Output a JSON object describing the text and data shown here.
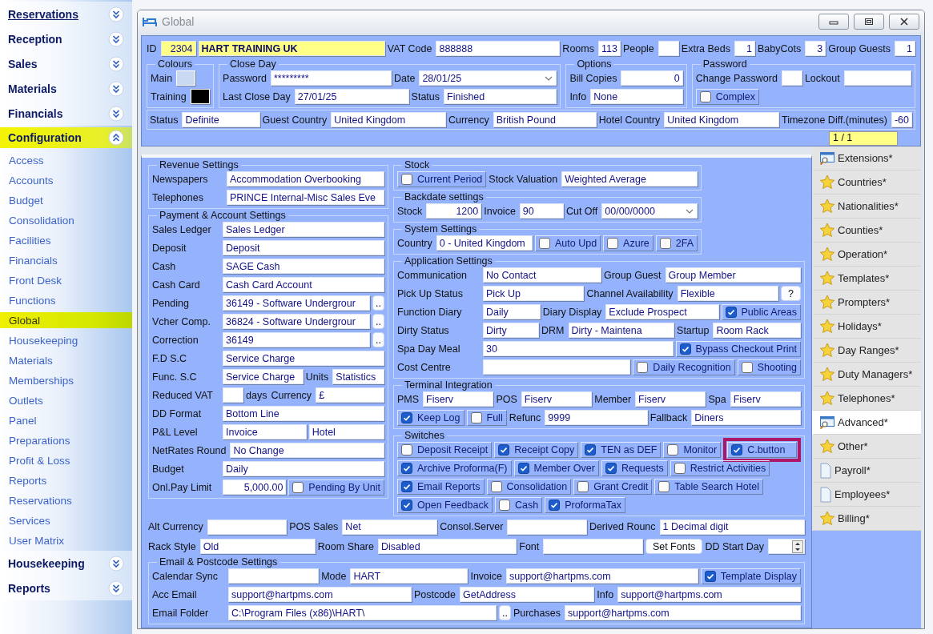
{
  "sidebar": {
    "sections": [
      {
        "title": "Reservations",
        "expanded": false,
        "hovered": true
      },
      {
        "title": "Reception",
        "expanded": false,
        "hovered": false
      },
      {
        "title": "Sales",
        "expanded": false,
        "hovered": false
      },
      {
        "title": "Materials",
        "expanded": false,
        "hovered": false
      },
      {
        "title": "Financials",
        "expanded": false,
        "hovered": false
      },
      {
        "title": "Configuration",
        "expanded": true,
        "hovered": false,
        "items": [
          {
            "label": "Access",
            "selected": false
          },
          {
            "label": "Accounts",
            "selected": false
          },
          {
            "label": "Budget",
            "selected": false
          },
          {
            "label": "Consolidation",
            "selected": false
          },
          {
            "label": "Facilities",
            "selected": false
          },
          {
            "label": "Financials",
            "selected": false
          },
          {
            "label": "Front Desk",
            "selected": false
          },
          {
            "label": "Functions",
            "selected": false
          },
          {
            "label": "Global",
            "selected": true
          },
          {
            "label": "Housekeeping",
            "selected": false
          },
          {
            "label": "Materials",
            "selected": false
          },
          {
            "label": "Memberships",
            "selected": false
          },
          {
            "label": "Outlets",
            "selected": false
          },
          {
            "label": "Panel",
            "selected": false
          },
          {
            "label": "Preparations",
            "selected": false
          },
          {
            "label": "Profit & Loss",
            "selected": false
          },
          {
            "label": "Reports",
            "selected": false
          },
          {
            "label": "Reservations",
            "selected": false
          },
          {
            "label": "Services",
            "selected": false
          },
          {
            "label": "User Matrix",
            "selected": false
          }
        ]
      },
      {
        "title": "Housekeeping",
        "expanded": false,
        "hovered": false
      },
      {
        "title": "Reports",
        "expanded": false,
        "hovered": false
      }
    ]
  },
  "window": {
    "title": "Global"
  },
  "header": {
    "row": [
      {
        "kind": "label",
        "text": "ID"
      },
      {
        "kind": "id",
        "value": "2304"
      },
      {
        "kind": "name",
        "value": "HART TRAINING UK"
      },
      {
        "kind": "label",
        "text": "VAT Code"
      },
      {
        "kind": "field",
        "value": "888888"
      },
      {
        "kind": "label",
        "text": "Rooms"
      },
      {
        "kind": "num",
        "value": "113"
      },
      {
        "kind": "label",
        "text": "People"
      },
      {
        "kind": "num"
      },
      {
        "kind": "label",
        "text": "Extra Beds"
      },
      {
        "kind": "num",
        "value": "1"
      },
      {
        "kind": "label",
        "text": "BabyCots"
      },
      {
        "kind": "num",
        "value": "3"
      },
      {
        "kind": "label",
        "text": "Group Guests"
      },
      {
        "kind": "num",
        "value": "1"
      }
    ],
    "groups": [
      {
        "title": "Colours",
        "rows": [
          {
            "items": [
              {
                "kind": "label",
                "text": "Main"
              },
              {
                "kind": "swatch",
                "color": "#c9d9f2"
              }
            ]
          },
          {
            "items": [
              {
                "kind": "label",
                "text": "Training"
              },
              {
                "kind": "swatch",
                "color": "#000000"
              }
            ]
          }
        ]
      },
      {
        "title": "Close Day",
        "rows": [
          {
            "items": [
              {
                "kind": "label",
                "text": "Password"
              },
              {
                "kind": "field",
                "value": "*********"
              },
              {
                "kind": "label",
                "text": "Date"
              },
              {
                "kind": "date",
                "value": "28/01/25"
              }
            ]
          },
          {
            "items": [
              {
                "kind": "label",
                "text": "Last Close Day"
              },
              {
                "kind": "field",
                "value": "27/01/25"
              },
              {
                "kind": "label",
                "text": "Status"
              },
              {
                "kind": "field",
                "value": "Finished"
              }
            ]
          }
        ]
      },
      {
        "title": "Options",
        "rows": [
          {
            "items": [
              {
                "kind": "label",
                "text": "Bill Copies"
              },
              {
                "kind": "wnum",
                "value": "0"
              }
            ]
          },
          {
            "items": [
              {
                "kind": "label",
                "text": "Info"
              },
              {
                "kind": "field",
                "value": "None"
              }
            ]
          }
        ]
      },
      {
        "title": "Password",
        "rows": [
          {
            "items": [
              {
                "kind": "label",
                "text": "Change Password"
              },
              {
                "kind": "num"
              },
              {
                "kind": "label",
                "text": "Lockout"
              },
              {
                "kind": "wnum"
              }
            ]
          },
          {
            "items": [
              {
                "kind": "check",
                "text": "Complex",
                "checked": false
              }
            ]
          }
        ]
      }
    ],
    "status_row": [
      {
        "kind": "label",
        "text": "Status"
      },
      {
        "kind": "field",
        "value": "Definite"
      },
      {
        "kind": "label",
        "text": "Guest Country"
      },
      {
        "kind": "field",
        "value": "United Kingdom"
      },
      {
        "kind": "label",
        "text": "Currency"
      },
      {
        "kind": "field",
        "value": "British Pound"
      },
      {
        "kind": "label",
        "text": "Hotel Country"
      },
      {
        "kind": "field",
        "value": "United Kingdom"
      },
      {
        "kind": "label",
        "text": "Timezone Diff.(minutes)"
      },
      {
        "kind": "num",
        "value": "-60"
      }
    ],
    "pager": "1 / 1"
  },
  "main": {
    "left": [
      {
        "title": "Revenue Settings",
        "rows": [
          {
            "items": [
              {
                "kind": "label",
                "text": "Newspapers"
              },
              {
                "kind": "field",
                "value": "Accommodation Overbooking"
              }
            ]
          },
          {
            "items": [
              {
                "kind": "label",
                "text": "Telephones"
              },
              {
                "kind": "field",
                "value": "PRINCE Internal-Misc Sales Eve"
              }
            ]
          }
        ]
      },
      {
        "title": "Payment & Account Settings",
        "rows": [
          {
            "items": [
              {
                "kind": "label",
                "text": "Sales Ledger"
              },
              {
                "kind": "field",
                "value": "Sales Ledger"
              }
            ]
          },
          {
            "items": [
              {
                "kind": "label",
                "text": "Deposit"
              },
              {
                "kind": "field",
                "value": "Deposit"
              }
            ]
          },
          {
            "items": [
              {
                "kind": "label",
                "text": "Cash"
              },
              {
                "kind": "field",
                "value": "SAGE Cash"
              }
            ]
          },
          {
            "items": [
              {
                "kind": "label",
                "text": "Cash Card"
              },
              {
                "kind": "field",
                "value": "Cash Card Account"
              }
            ]
          },
          {
            "items": [
              {
                "kind": "label",
                "text": "Pending"
              },
              {
                "kind": "field",
                "value": "36149 - Software Undergrour"
              },
              {
                "kind": "dots",
                "text": ".."
              }
            ]
          },
          {
            "items": [
              {
                "kind": "label",
                "text": "Vcher Comp."
              },
              {
                "kind": "field",
                "value": "36824 - Software Undergrour"
              },
              {
                "kind": "dots",
                "text": ".."
              }
            ]
          },
          {
            "items": [
              {
                "kind": "label",
                "text": "Correction"
              },
              {
                "kind": "field",
                "value": "36149"
              },
              {
                "kind": "dots",
                "text": ".."
              }
            ]
          },
          {
            "items": [
              {
                "kind": "label",
                "text": "F.D S.C"
              },
              {
                "kind": "field",
                "value": "Service Charge"
              }
            ]
          },
          {
            "items": [
              {
                "kind": "label",
                "text": "Func. S.C"
              },
              {
                "kind": "field",
                "value": "Service Charge"
              },
              {
                "kind": "label",
                "text": "Units"
              },
              {
                "kind": "field",
                "value": "Statistics"
              }
            ]
          },
          {
            "items": [
              {
                "kind": "label",
                "text": "Reduced VAT"
              },
              {
                "kind": "num"
              },
              {
                "kind": "label",
                "text": "days"
              },
              {
                "kind": "label",
                "text": "Currency"
              },
              {
                "kind": "field",
                "value": "£"
              }
            ]
          },
          {
            "items": [
              {
                "kind": "label",
                "text": "DD Format"
              },
              {
                "kind": "field",
                "value": "Bottom Line"
              }
            ]
          },
          {
            "items": [
              {
                "kind": "label",
                "text": "P&L Level"
              },
              {
                "kind": "field",
                "value": "Invoice"
              },
              {
                "kind": "field",
                "value": "Hotel"
              }
            ]
          },
          {
            "items": [
              {
                "kind": "label",
                "text": "NetRates Round"
              },
              {
                "kind": "field",
                "value": "No Change"
              }
            ]
          },
          {
            "items": [
              {
                "kind": "label",
                "text": "Budget"
              },
              {
                "kind": "field",
                "value": "Daily"
              }
            ]
          },
          {
            "items": [
              {
                "kind": "label",
                "text": "Onl.Pay Limit"
              },
              {
                "kind": "wnum",
                "value": "5,000.00"
              },
              {
                "kind": "check",
                "text": "Pending By Unit",
                "checked": false
              }
            ]
          }
        ]
      }
    ],
    "right": [
      {
        "title": "Stock",
        "rows": [
          {
            "items": [
              {
                "kind": "check",
                "text": "Current Period",
                "checked": false
              },
              {
                "kind": "label",
                "text": "Stock Valuation"
              },
              {
                "kind": "field",
                "value": "Weighted Average"
              }
            ]
          }
        ]
      },
      {
        "title": "Backdate settings",
        "rows": [
          {
            "items": [
              {
                "kind": "label",
                "text": "Stock"
              },
              {
                "kind": "wnum",
                "value": "1200"
              },
              {
                "kind": "label",
                "text": "Invoice"
              },
              {
                "kind": "field",
                "value": "90"
              },
              {
                "kind": "label",
                "text": "Cut Off"
              },
              {
                "kind": "date",
                "value": "00/00/0000"
              }
            ]
          }
        ]
      },
      {
        "title": "System Settings",
        "rows": [
          {
            "items": [
              {
                "kind": "label",
                "text": "Country"
              },
              {
                "kind": "field",
                "value": "0 - United Kingdom"
              },
              {
                "kind": "check",
                "text": "Auto Upd",
                "checked": false
              },
              {
                "kind": "check",
                "text": "Azure",
                "checked": false
              },
              {
                "kind": "check",
                "text": "2FA",
                "checked": false
              }
            ]
          }
        ]
      },
      {
        "title": "Application Settings",
        "rows": [
          {
            "items": [
              {
                "kind": "label",
                "text": "Communication"
              },
              {
                "kind": "field",
                "value": "No Contact"
              },
              {
                "kind": "label",
                "text": "Group Guest"
              },
              {
                "kind": "field",
                "value": "Group Member"
              }
            ]
          },
          {
            "items": [
              {
                "kind": "label",
                "text": "Pick Up Status"
              },
              {
                "kind": "field",
                "value": "Pick Up"
              },
              {
                "kind": "label",
                "text": "Channel Availability"
              },
              {
                "kind": "field",
                "value": "Flexible"
              },
              {
                "kind": "button",
                "text": "?"
              }
            ]
          },
          {
            "items": [
              {
                "kind": "label",
                "text": "Function Diary"
              },
              {
                "kind": "field",
                "value": "Daily"
              },
              {
                "kind": "label",
                "text": "Diary Display"
              },
              {
                "kind": "field",
                "value": "Exclude Prospect"
              },
              {
                "kind": "check",
                "text": "Public Areas",
                "checked": true
              }
            ]
          },
          {
            "items": [
              {
                "kind": "label",
                "text": "Dirty Status"
              },
              {
                "kind": "field",
                "value": "Dirty"
              },
              {
                "kind": "label",
                "text": "DRM"
              },
              {
                "kind": "field",
                "value": "Dirty - Maintena"
              },
              {
                "kind": "label",
                "text": "Startup"
              },
              {
                "kind": "field",
                "value": "Room Rack"
              }
            ]
          },
          {
            "items": [
              {
                "kind": "label",
                "text": "Spa Day Meal"
              },
              {
                "kind": "field",
                "value": "30"
              },
              {
                "kind": "check",
                "text": "Bypass Checkout Print",
                "checked": true
              }
            ]
          },
          {
            "items": [
              {
                "kind": "label",
                "text": "Cost Centre"
              },
              {
                "kind": "field"
              },
              {
                "kind": "check",
                "text": "Daily Recognition",
                "checked": false
              },
              {
                "kind": "check",
                "text": "Shooting",
                "checked": false
              }
            ]
          }
        ]
      },
      {
        "title": "Terminal Integration",
        "rows": [
          {
            "items": [
              {
                "kind": "label",
                "text": "PMS"
              },
              {
                "kind": "field",
                "value": "Fiserv"
              },
              {
                "kind": "label",
                "text": "POS"
              },
              {
                "kind": "field",
                "value": "Fiserv"
              },
              {
                "kind": "label",
                "text": "Member"
              },
              {
                "kind": "field",
                "value": "Fiserv"
              },
              {
                "kind": "label",
                "text": "Spa"
              },
              {
                "kind": "field",
                "value": "Fiserv"
              }
            ]
          },
          {
            "items": [
              {
                "kind": "check",
                "text": "Keep Log",
                "checked": true
              },
              {
                "kind": "check",
                "text": "Full",
                "checked": false
              },
              {
                "kind": "label",
                "text": "Refunc"
              },
              {
                "kind": "field",
                "value": "9999"
              },
              {
                "kind": "label",
                "text": "Fallback"
              },
              {
                "kind": "field",
                "value": "Diners"
              }
            ]
          }
        ]
      },
      {
        "title": "Switches",
        "rows": [
          {
            "items": [
              {
                "kind": "check",
                "text": "Deposit Receipt",
                "checked": false
              },
              {
                "kind": "check",
                "text": "Receipt Copy",
                "checked": true
              },
              {
                "kind": "check",
                "text": "TEN as DEF",
                "checked": true
              },
              {
                "kind": "check",
                "text": "Monitor",
                "checked": false
              },
              {
                "kind": "check",
                "text": "C.button",
                "checked": true,
                "highlighted": true
              }
            ]
          },
          {
            "items": [
              {
                "kind": "check",
                "text": "Archive Proforma(F)",
                "checked": true
              },
              {
                "kind": "check",
                "text": "Member Over",
                "checked": true
              },
              {
                "kind": "check",
                "text": "Requests",
                "checked": true
              },
              {
                "kind": "check",
                "text": "Restrict Activities",
                "checked": false
              }
            ]
          },
          {
            "items": [
              {
                "kind": "check",
                "text": "Email Reports",
                "checked": true
              },
              {
                "kind": "check",
                "text": "Consolidation",
                "checked": false
              },
              {
                "kind": "check",
                "text": "Grant Credit",
                "checked": false
              },
              {
                "kind": "check",
                "text": "Table Search Hotel",
                "checked": false
              }
            ]
          },
          {
            "items": [
              {
                "kind": "check",
                "text": "Open Feedback",
                "checked": true
              },
              {
                "kind": "check",
                "text": "Cash",
                "checked": false
              },
              {
                "kind": "check",
                "text": "ProformaTax",
                "checked": true
              }
            ]
          }
        ]
      }
    ],
    "rows": [
      {
        "items": [
          {
            "kind": "label",
            "text": "Alt Currency"
          },
          {
            "kind": "field"
          },
          {
            "kind": "label",
            "text": "POS Sales"
          },
          {
            "kind": "field",
            "value": "Net"
          },
          {
            "kind": "label",
            "text": "Consol.Server"
          },
          {
            "kind": "field"
          },
          {
            "kind": "label",
            "text": "Derived Rounc"
          },
          {
            "kind": "field",
            "value": "1 Decimal digit"
          }
        ]
      },
      {
        "items": [
          {
            "kind": "label",
            "text": "Rack Style"
          },
          {
            "kind": "field",
            "value": "Old"
          },
          {
            "kind": "label",
            "text": "Room Share"
          },
          {
            "kind": "field",
            "value": "Disabled"
          },
          {
            "kind": "label",
            "text": "Font"
          },
          {
            "kind": "field"
          },
          {
            "kind": "button",
            "text": "Set Fonts"
          },
          {
            "kind": "label",
            "text": "DD Start Day"
          },
          {
            "kind": "spin"
          }
        ]
      }
    ],
    "email": {
      "title": "Email & Postcode Settings",
      "rows": [
        {
          "items": [
            {
              "kind": "label",
              "text": "Calendar Sync"
            },
            {
              "kind": "field"
            },
            {
              "kind": "label",
              "text": "Mode"
            },
            {
              "kind": "field",
              "value": "HART"
            },
            {
              "kind": "label",
              "text": "Invoice"
            },
            {
              "kind": "field",
              "value": "support@hartpms.com"
            },
            {
              "kind": "check",
              "text": "Template Display",
              "checked": true
            }
          ]
        },
        {
          "items": [
            {
              "kind": "label",
              "text": "Acc Email"
            },
            {
              "kind": "field",
              "value": "support@hartpms.com"
            },
            {
              "kind": "label",
              "text": "Postcode"
            },
            {
              "kind": "field",
              "value": "GetAddress"
            },
            {
              "kind": "label",
              "text": "Info"
            },
            {
              "kind": "field",
              "value": "support@hartpms.com"
            }
          ]
        },
        {
          "items": [
            {
              "kind": "label",
              "text": "Email Folder"
            },
            {
              "kind": "field",
              "value": "C:\\Program Files (x86)\\HART\\"
            },
            {
              "kind": "dots",
              "text": ".."
            },
            {
              "kind": "label",
              "text": "Purchases"
            },
            {
              "kind": "field",
              "value": "support@hartpms.com"
            }
          ]
        }
      ]
    }
  },
  "side_list": [
    {
      "text": "Extensions*",
      "kind": "window",
      "selected": false
    },
    {
      "text": "Countries*",
      "kind": "star",
      "selected": false
    },
    {
      "text": "Nationalities*",
      "kind": "star",
      "selected": false
    },
    {
      "text": "Counties*",
      "kind": "star",
      "selected": false
    },
    {
      "text": "Operation*",
      "kind": "star",
      "selected": false
    },
    {
      "text": "Templates*",
      "kind": "star",
      "selected": false
    },
    {
      "text": "Prompters*",
      "kind": "star",
      "selected": false
    },
    {
      "text": "Holidays*",
      "kind": "star",
      "selected": false
    },
    {
      "text": "Day Ranges*",
      "kind": "star",
      "selected": false
    },
    {
      "text": "Duty Managers*",
      "kind": "star",
      "selected": false
    },
    {
      "text": "Telephones*",
      "kind": "star",
      "selected": false
    },
    {
      "text": "Advanced*",
      "kind": "window",
      "selected": true
    },
    {
      "text": "Other*",
      "kind": "star",
      "selected": false
    },
    {
      "text": "Payroll*",
      "kind": "page",
      "selected": false
    },
    {
      "text": "Employees*",
      "kind": "page",
      "selected": false
    },
    {
      "text": "Billing*",
      "kind": "star",
      "selected": false
    }
  ]
}
